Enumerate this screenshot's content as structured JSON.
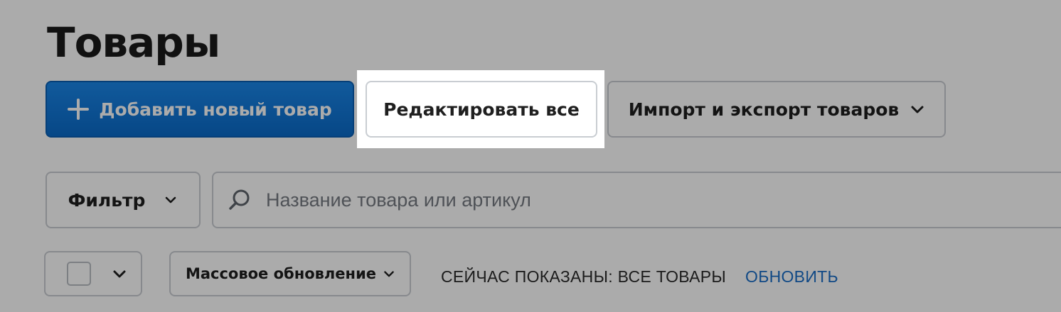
{
  "page": {
    "title": "Товары"
  },
  "toolbar": {
    "add_product_label": "Добавить новый товар",
    "edit_all_label": "Редактировать все",
    "import_export_label": "Импорт и экспорт товаров"
  },
  "filters": {
    "filter_label": "Фильтр",
    "search_placeholder": "Название товара или артикул",
    "search_value": ""
  },
  "list_controls": {
    "bulk_update_label": "Массовое обновление",
    "status_text": "СЕЙЧАС ПОКАЗАНЫ: ВСЕ ТОВАРЫ",
    "refresh_label": "ОБНОВИТЬ"
  },
  "icons": {
    "add": "plus-icon",
    "dropdown": "chevron-down-icon",
    "search": "search-icon"
  },
  "colors": {
    "primary": "#0a6bc9",
    "link": "#1a6ec7",
    "overlay": "rgba(0,0,0,0.33)"
  }
}
